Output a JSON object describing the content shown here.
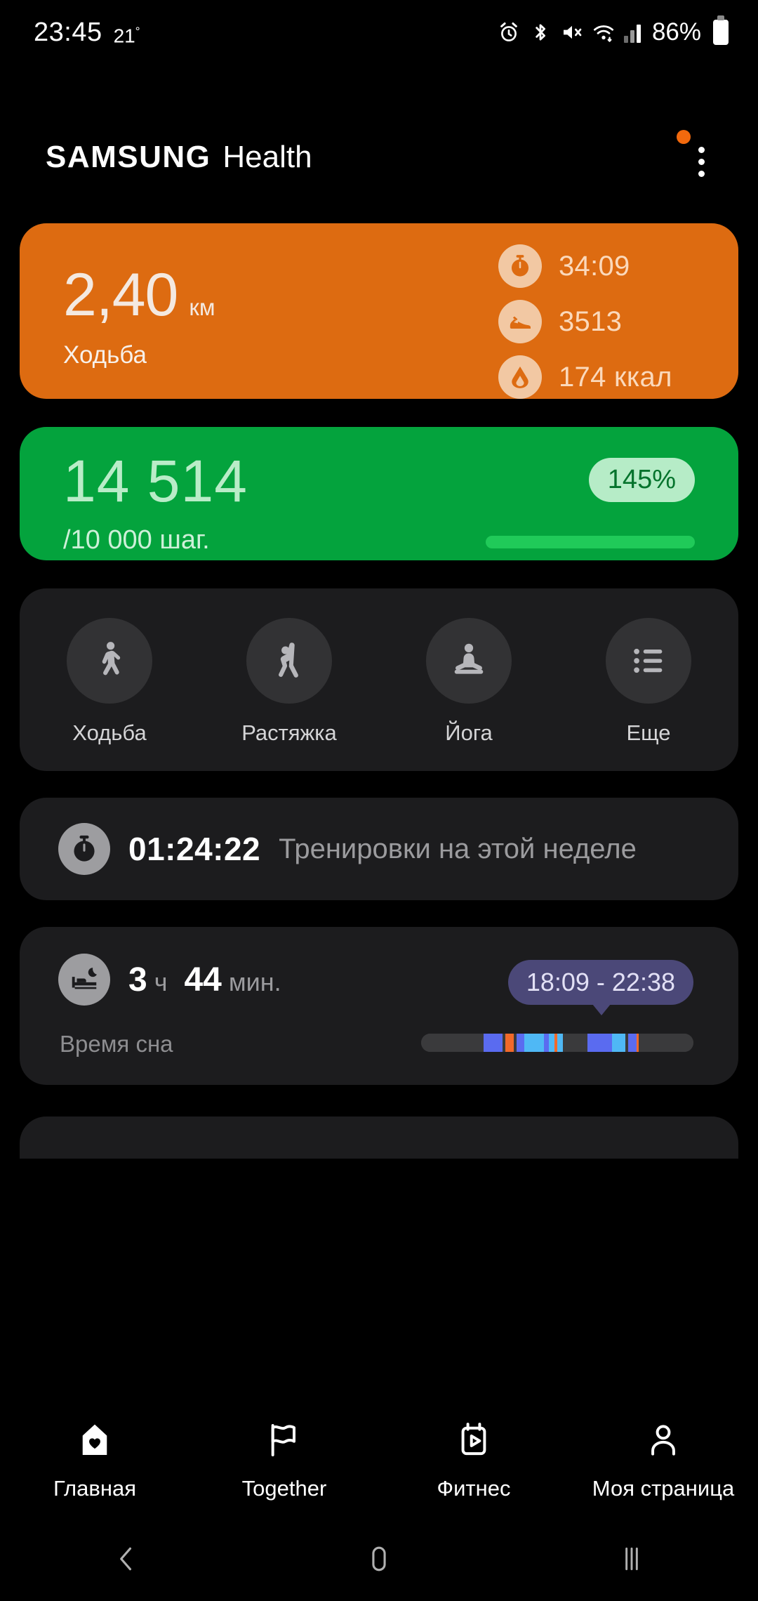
{
  "status_bar": {
    "time": "23:45",
    "temperature": "21",
    "degree": "°",
    "battery": "86%",
    "icons": [
      "alarm-icon",
      "bluetooth-icon",
      "mute-icon",
      "wifi-icon",
      "signal-icon",
      "battery-icon"
    ]
  },
  "header": {
    "brand": "SAMSUNG",
    "app": "Health",
    "more_label": "more-options",
    "has_notification_dot": true
  },
  "exercise_card": {
    "value": "2,40",
    "unit": "км",
    "name": "Ходьба",
    "accent": "#dd6b11",
    "stats": [
      {
        "icon": "stopwatch-icon",
        "value": "34:09"
      },
      {
        "icon": "shoe-icon",
        "value": "3513"
      },
      {
        "icon": "flame-icon",
        "value": "174 ккал"
      }
    ]
  },
  "steps_card": {
    "steps": "14 514",
    "goal": "/10 000 шаг.",
    "percent": "145%",
    "progress": 100,
    "accent": "#04a33d",
    "badge_bg": "#b6ecc7",
    "badge_fg": "#04732c"
  },
  "shortcuts": {
    "items": [
      {
        "icon": "walking-icon",
        "label": "Ходьба"
      },
      {
        "icon": "stretching-icon",
        "label": "Растяжка"
      },
      {
        "icon": "yoga-icon",
        "label": "Йога"
      },
      {
        "icon": "list-more-icon",
        "label": "Еще"
      }
    ]
  },
  "workout_card": {
    "icon": "stopwatch-icon",
    "duration": "01:24:22",
    "label": "Тренировки на этой неделе"
  },
  "sleep_card": {
    "icon": "bed-moon-icon",
    "hours": "3",
    "hours_unit": "ч",
    "minutes": "44",
    "minutes_unit": "мин.",
    "label": "Время сна",
    "range": "18:09 - 22:38",
    "tooltip_bg": "#4b4878",
    "segments": [
      {
        "color": "#3a3a3c",
        "width": 23
      },
      {
        "color": "#5a6bf0",
        "width": 7
      },
      {
        "color": "#3a3a3c",
        "width": 1
      },
      {
        "color": "#f2692a",
        "width": 3
      },
      {
        "color": "#3a3a3c",
        "width": 1
      },
      {
        "color": "#5a6bf0",
        "width": 3
      },
      {
        "color": "#4fb8f5",
        "width": 7
      },
      {
        "color": "#5a6bf0",
        "width": 2
      },
      {
        "color": "#4fb8f5",
        "width": 2
      },
      {
        "color": "#f2692a",
        "width": 1
      },
      {
        "color": "#4fb8f5",
        "width": 2
      },
      {
        "color": "#3a3a3c",
        "width": 9
      },
      {
        "color": "#5a6bf0",
        "width": 9
      },
      {
        "color": "#4fb8f5",
        "width": 5
      },
      {
        "color": "#3a3a3c",
        "width": 1
      },
      {
        "color": "#5a6bf0",
        "width": 3
      },
      {
        "color": "#f2692a",
        "width": 1
      },
      {
        "color": "#3a3a3c",
        "width": 20
      }
    ]
  },
  "bottom_nav": {
    "items": [
      {
        "icon": "home-heart-icon",
        "label": "Главная",
        "active": true
      },
      {
        "icon": "flag-icon",
        "label": "Together",
        "active": false
      },
      {
        "icon": "fitness-video-icon",
        "label": "Фитнес",
        "active": false
      },
      {
        "icon": "person-icon",
        "label": "Моя страница",
        "active": false
      }
    ]
  },
  "system_nav": {
    "items": [
      "back-icon",
      "home-icon",
      "recents-icon"
    ]
  }
}
